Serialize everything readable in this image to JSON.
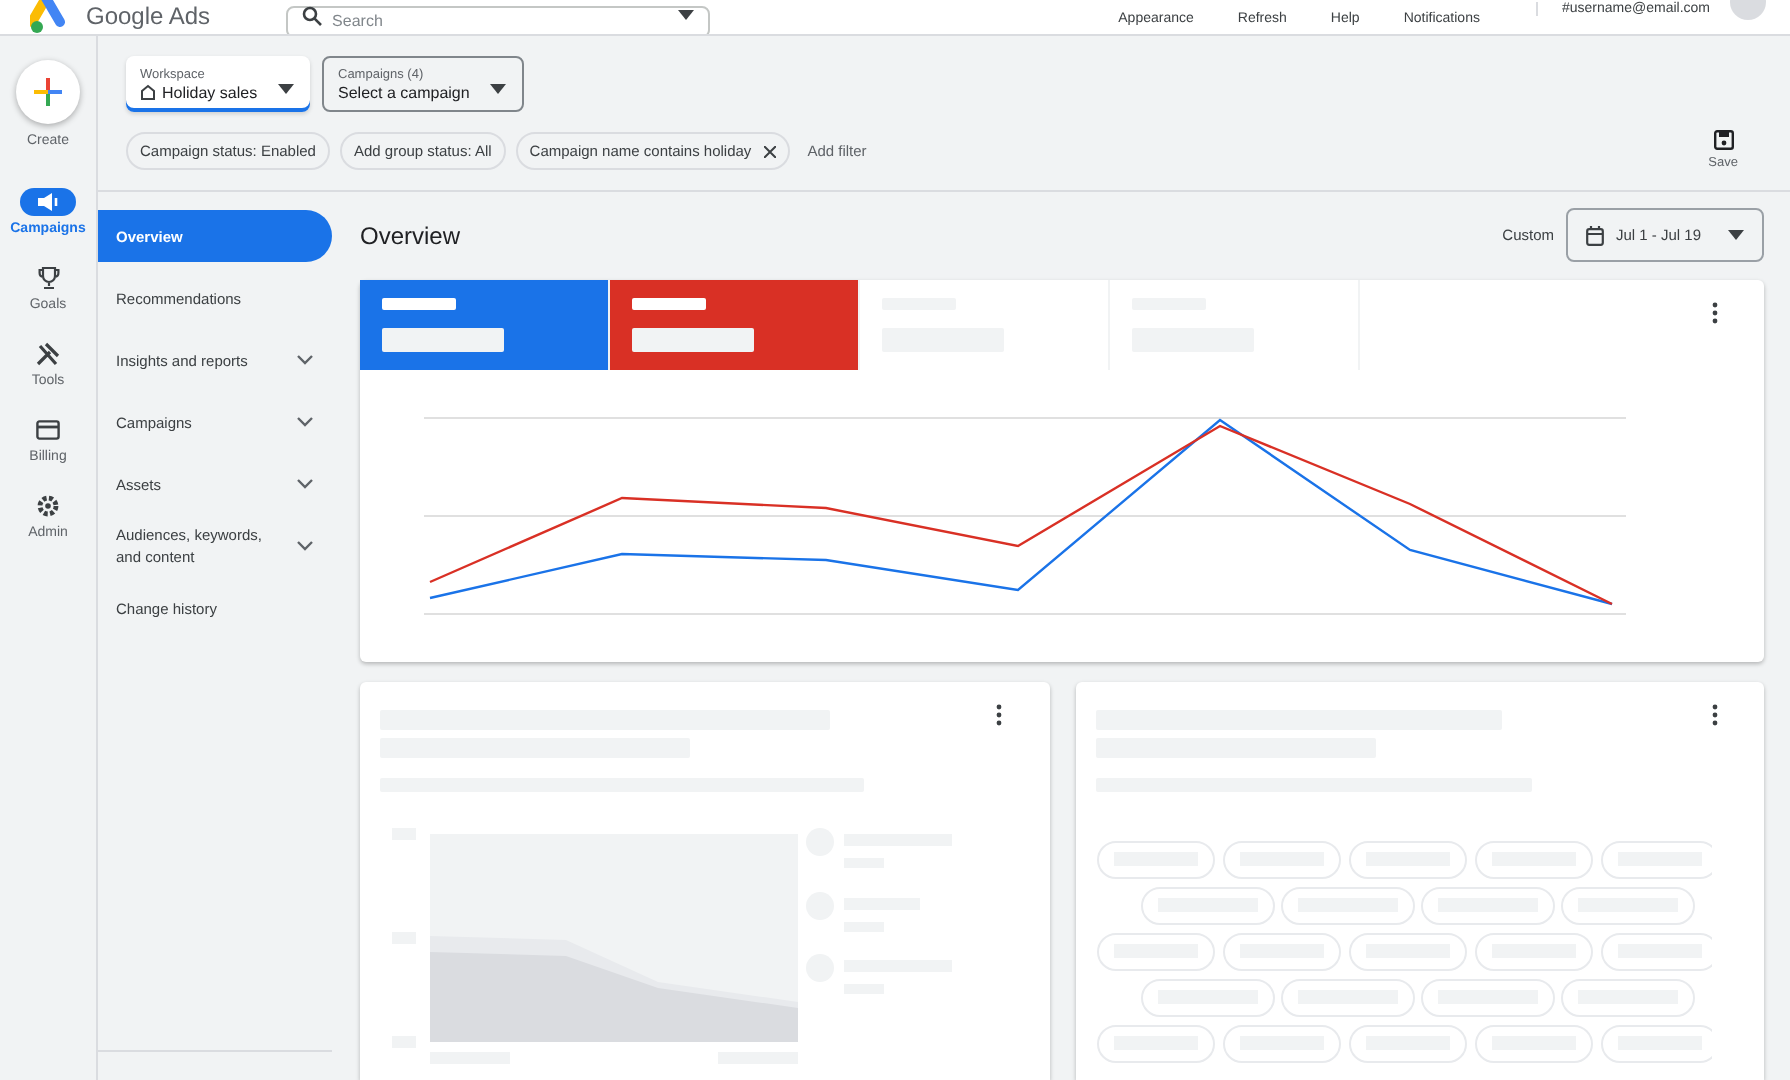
{
  "header": {
    "logo": "Google Ads",
    "search": {
      "placeholder": "Search"
    },
    "links": [
      "Appearance",
      "Refresh",
      "Help",
      "Notifications"
    ],
    "account": "#username@email.com"
  },
  "rail": [
    {
      "label": "Create",
      "kind": "create",
      "selected": false
    },
    {
      "label": "Campaigns",
      "kind": "campaigns",
      "selected": true
    },
    {
      "label": "Goals",
      "kind": "goals",
      "selected": false
    },
    {
      "label": "Tools",
      "kind": "tools",
      "selected": false
    },
    {
      "label": "Billing",
      "kind": "billing",
      "selected": false
    },
    {
      "label": "Admin",
      "kind": "admin",
      "selected": false
    }
  ],
  "selectors": [
    {
      "label": "Workspace",
      "value": "Holiday sales",
      "focused": true
    },
    {
      "label": "Campaigns (4)",
      "value": "Select a campaign",
      "focused": false
    }
  ],
  "filters": [
    {
      "label": "Campaign status: Enabled",
      "removable": false
    },
    {
      "label": "Add group status: All",
      "removable": false
    },
    {
      "label": "Campaign name contains holiday",
      "removable": true
    }
  ],
  "add_filter": "Add filter",
  "save": "Save",
  "nav": [
    {
      "label": "Overview",
      "selected": true,
      "expandable": false
    },
    {
      "label": "Recommendations",
      "selected": false,
      "expandable": false
    },
    {
      "label": "Insights and reports",
      "selected": false,
      "expandable": true
    },
    {
      "label": "Campaigns",
      "selected": false,
      "expandable": true
    },
    {
      "label": "Assets",
      "selected": false,
      "expandable": true
    },
    {
      "label": "Audiences, keywords, and content",
      "selected": false,
      "expandable": true
    },
    {
      "label": "Change history",
      "selected": false,
      "expandable": false
    }
  ],
  "overview": {
    "title": "Overview",
    "range_label": "Custom",
    "date_range": "Jul 1 - Jul 19",
    "metrics": [
      {
        "selected": true,
        "color": "#1a73e8"
      },
      {
        "selected": true,
        "color": "#d93025"
      },
      {
        "selected": false
      },
      {
        "selected": false
      }
    ]
  }
}
